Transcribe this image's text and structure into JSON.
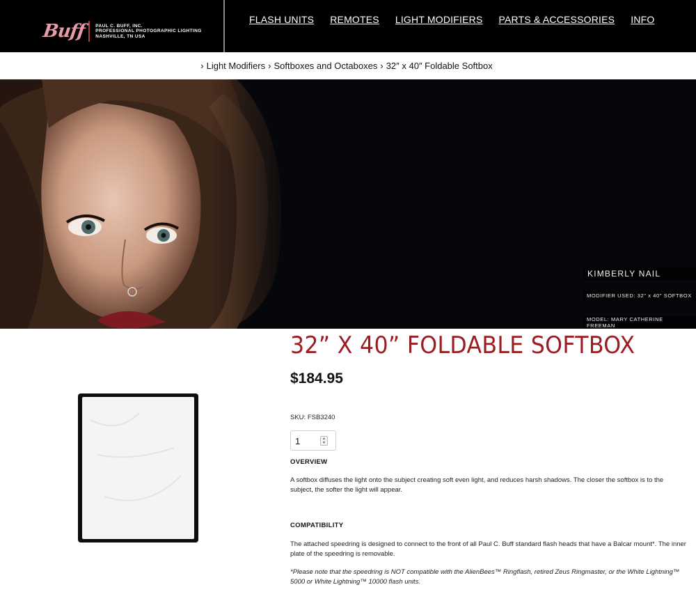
{
  "header": {
    "logo": {
      "script": "Buff",
      "lines": [
        "PAUL C. BUFF, INC.",
        "PROFESSIONAL PHOTOGRAPHIC LIGHTING",
        "NASHVILLE, TN USA"
      ]
    },
    "nav": [
      "FLASH UNITS",
      "REMOTES",
      "LIGHT MODIFIERS",
      "PARTS & ACCESSORIES",
      "INFO"
    ]
  },
  "breadcrumb": {
    "sep": "›",
    "items": [
      "Light Modifiers",
      "Softboxes and Octaboxes",
      "32″ x 40″ Foldable Softbox"
    ]
  },
  "hero": {
    "photographer": "KIMBERLY NAIL",
    "modifier": "MODIFIER USED: 32\" x 40\" SOFTBOX",
    "model": "MODEL: MARY CATHERINE FREEMAN"
  },
  "product": {
    "title": "32” X 40” FOLDABLE SOFTBOX",
    "price": "$184.95",
    "sku_label": "SKU:",
    "sku": "FSB3240",
    "quantity": "1",
    "overview_heading": "OVERVIEW",
    "overview_text": "A softbox diffuses the light onto the subject creating soft even light, and reduces harsh shadows. The closer the softbox is to the subject, the softer the light will appear.",
    "compat_heading": "COMPATIBILITY",
    "compat_text": "The attached speedring is designed to connect to the front of all Paul C. Buff standard flash heads that have a Balcar mount*. The inner plate of the speedring is removable.",
    "compat_note": "*Please note that the speedring is NOT compatible with the AlienBees™ Ringflash, retired Zeus Ringmaster, or the White Lightning™ 5000 or White Lightning™ 10000 flash units."
  },
  "colors": {
    "title": "#9b1d22",
    "header_bg": "#000000",
    "logo_pink": "#e79aa7"
  }
}
